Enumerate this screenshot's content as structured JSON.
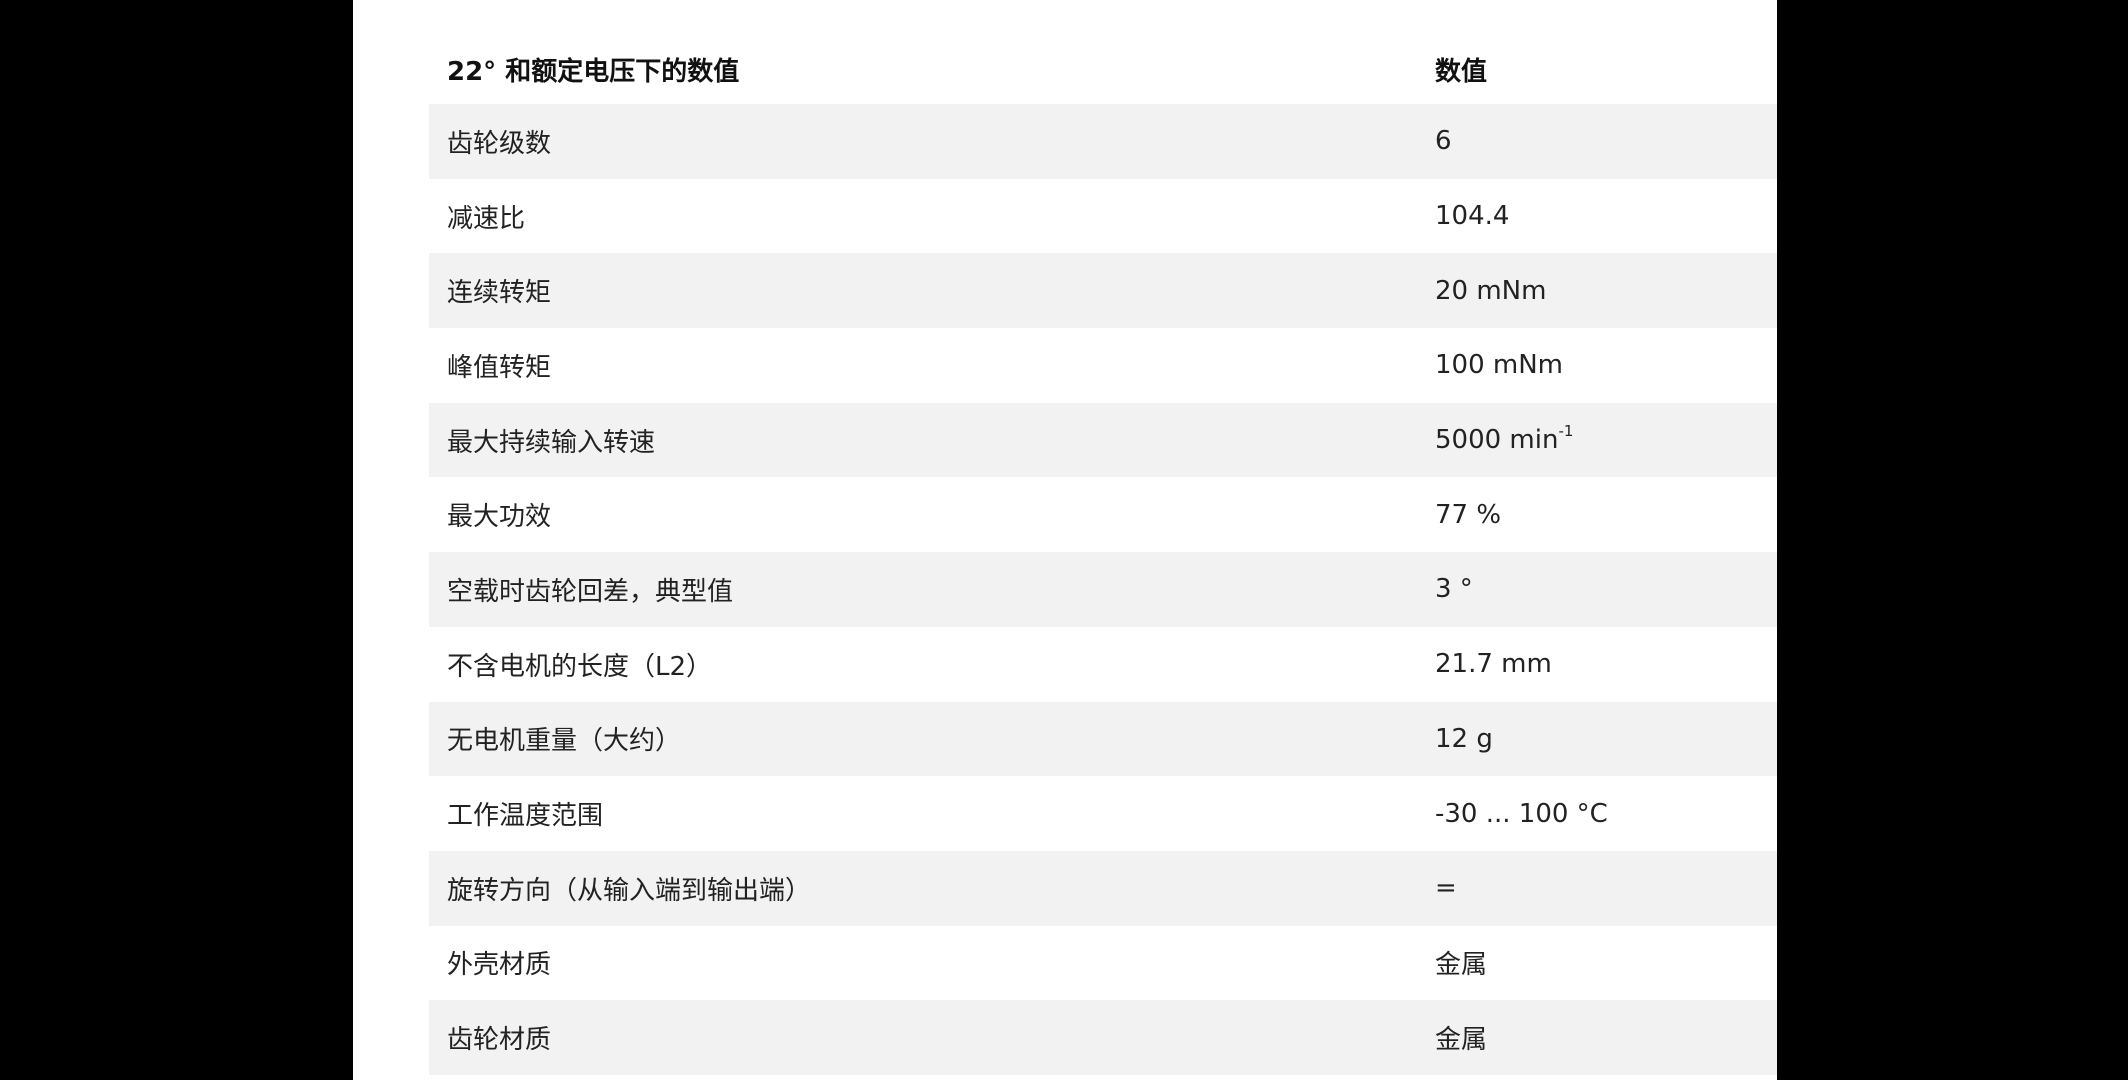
{
  "table": {
    "header": {
      "parameter": "22° 和额定电压下的数值",
      "value": "数值"
    },
    "rows": [
      {
        "label": "齿轮级数",
        "value": "6"
      },
      {
        "label": "减速比",
        "value": "104.4"
      },
      {
        "label": "连续转矩",
        "value": "20 mNm"
      },
      {
        "label": "峰值转矩",
        "value": "100 mNm"
      },
      {
        "label": "最大持续输入转速",
        "value": "5000 min",
        "sup": "-1"
      },
      {
        "label": "最大功效",
        "value": "77 %"
      },
      {
        "label": "空载时齿轮回差，典型值",
        "value": "3 °"
      },
      {
        "label": "不含电机的长度（L2）",
        "value": "21.7 mm"
      },
      {
        "label": "无电机重量（大约）",
        "value": "12 g"
      },
      {
        "label": "工作温度范围",
        "value": "-30 ... 100 °C"
      },
      {
        "label": "旋转方向（从输入端到输出端）",
        "value": "="
      },
      {
        "label": "外壳材质",
        "value": "金属"
      },
      {
        "label": "齿轮材质",
        "value": "金属"
      }
    ]
  },
  "colors": {
    "backdrop": "#000000",
    "panel": "#ffffff",
    "stripe": "#f2f2f2",
    "text": "#222222"
  }
}
